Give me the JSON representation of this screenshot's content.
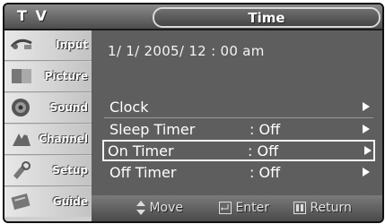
{
  "header": {
    "source_label": "T V",
    "menu_title": "Time"
  },
  "sidebar": {
    "items": [
      {
        "label": "Input",
        "icon": "input-icon"
      },
      {
        "label": "Picture",
        "icon": "picture-icon"
      },
      {
        "label": "Sound",
        "icon": "sound-icon"
      },
      {
        "label": "Channel",
        "icon": "channel-icon"
      },
      {
        "label": "Setup",
        "icon": "setup-icon"
      },
      {
        "label": "Guide",
        "icon": "guide-icon"
      }
    ]
  },
  "main": {
    "current_datetime": "1/ 1/ 2005/ 12 : 00  am",
    "rows": [
      {
        "label": "Clock",
        "value": ""
      },
      {
        "label": "Sleep Timer",
        "value": ": Off"
      },
      {
        "label": "On Timer",
        "value": ": Off",
        "selected": true
      },
      {
        "label": "Off Timer",
        "value": ": Off"
      }
    ]
  },
  "controls": {
    "move_label": "Move",
    "enter_label": "Enter",
    "return_label": "Return"
  },
  "colors": {
    "panel_bg": "#5e5e5e",
    "sidebar_bg": "#cfcfcf",
    "text": "#ffffff"
  }
}
